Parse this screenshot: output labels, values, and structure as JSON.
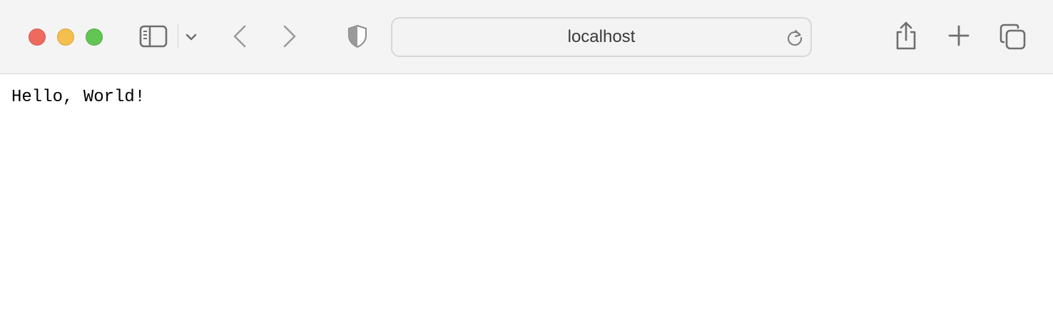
{
  "browser": {
    "address_bar": {
      "url": "localhost"
    },
    "toolbar": {
      "icons": {
        "close": "close-traffic-light",
        "minimize": "minimize-traffic-light",
        "maximize": "maximize-traffic-light",
        "sidebar": "sidebar-icon",
        "tab_group_menu": "chevron-down-icon",
        "back": "chevron-left-icon",
        "forward": "chevron-right-icon",
        "privacy": "shield-icon",
        "reload": "reload-icon",
        "share": "share-icon",
        "new_tab": "plus-icon",
        "tab_overview": "tab-overview-icon"
      }
    }
  },
  "page": {
    "body_text": "Hello, World!"
  },
  "colors": {
    "close": "#ee6a5f",
    "minimize": "#f5bf4f",
    "maximize": "#62c554",
    "toolbar_bg": "#f4f4f4"
  }
}
